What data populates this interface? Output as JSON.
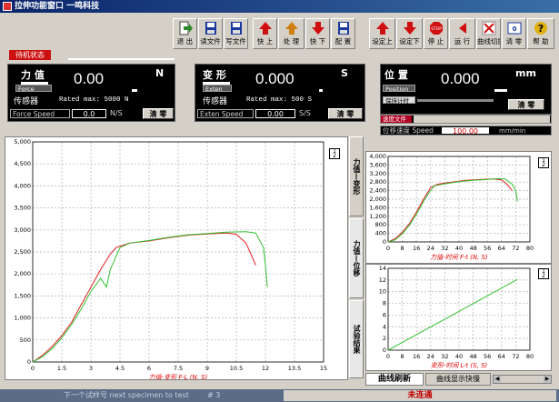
{
  "window": {
    "title": "拉伸功能窗口  一鸣科技"
  },
  "status_label": "待机状态",
  "toolbar": [
    {
      "name": "exit",
      "label": "退 出",
      "icon": "exit-icon",
      "color": "#2a8a2a"
    },
    {
      "name": "read-file",
      "label": "读文件",
      "icon": "read-file-icon",
      "color": "#1a3aa0"
    },
    {
      "name": "write-file",
      "label": "写文件",
      "icon": "write-file-icon",
      "color": "#1a3aa0"
    },
    {
      "name": "fast-up",
      "label": "快 上",
      "icon": "arrow-up-icon",
      "color": "#d01010"
    },
    {
      "name": "process",
      "label": "处 理",
      "icon": "process-icon",
      "color": "#d08010"
    },
    {
      "name": "fast-down",
      "label": "快 下",
      "icon": "arrow-down-icon",
      "color": "#d01010"
    },
    {
      "name": "config",
      "label": "配 置",
      "icon": "config-icon",
      "color": "#1a3aa0"
    },
    {
      "name": "set-up",
      "label": "设定上",
      "icon": "arrow-up-icon",
      "color": "#d01010"
    },
    {
      "name": "set-down",
      "label": "设定下",
      "icon": "arrow-down-icon",
      "color": "#d01010"
    },
    {
      "name": "stop",
      "label": "停 止",
      "icon": "stop-icon",
      "color": "#d01010"
    },
    {
      "name": "run",
      "label": "运 行",
      "icon": "run-icon",
      "color": "#d01010"
    },
    {
      "name": "curve-clear",
      "label": "曲线切换",
      "icon": "curve-switch-icon",
      "color": "#3060c0"
    },
    {
      "name": "clear-zero",
      "label": "清 零",
      "icon": "clear-zero-icon",
      "color": "#1a3aa0"
    },
    {
      "name": "help",
      "label": "帮 助",
      "icon": "help-icon",
      "color": "#e0b010"
    }
  ],
  "force": {
    "label": "力 值",
    "value": "0.00",
    "unit": "N",
    "tag": "Force",
    "sensor_label": "传感器",
    "rated": "Rated max: 5000 N",
    "speed_label": "Force Speed",
    "speed_value": "0.0",
    "speed_unit": "N/S",
    "clear_label": "清 零"
  },
  "deform": {
    "label": "变 形",
    "value": "0.000",
    "unit": "S",
    "tag": "Exten",
    "sensor_label": "传感器",
    "rated": "Rated max: 500 S",
    "speed_label": "Exten Speed",
    "speed_value": "0.00",
    "speed_unit": "S/S",
    "clear_label": "清 零"
  },
  "position": {
    "label": "位 置",
    "value": "0.000",
    "unit": "mm",
    "tag": "Position",
    "hold_label": "保持计时",
    "clear_label": "清 零",
    "speed_file_label": "速度文件",
    "speed_label": "位移速度 Speed",
    "speed_value": "100.00",
    "speed_unit": "mm/min"
  },
  "tabs": {
    "vertical": [
      "力值—变形",
      "力值—位移",
      "试验结果"
    ],
    "refresh": "曲线刷新",
    "display_speed": "曲线显示快慢"
  },
  "legend": {
    "top": "1",
    "bottom": "2"
  },
  "footer": {
    "left": "下一个试样号 next specimen to test",
    "count": "# 3",
    "status": "未连通"
  },
  "charts": {
    "main": {
      "xlabel": "力值-变形 F-L  (N, S)",
      "xlim": [
        0,
        15
      ],
      "ylim": [
        0,
        5000
      ],
      "xticks": [
        "0",
        "1.5",
        "3",
        "4.5",
        "6",
        "7.5",
        "9",
        "10.5",
        "12",
        "13.5",
        "15"
      ],
      "yticks": [
        "0",
        "500",
        "1,000",
        "1,500",
        "2,000",
        "2,500",
        "3,000",
        "3,500",
        "4,000",
        "4,500",
        "5,000"
      ],
      "series": [
        {
          "color": "#e02020",
          "points": [
            [
              0,
              0
            ],
            [
              0.5,
              150
            ],
            [
              1,
              350
            ],
            [
              1.5,
              600
            ],
            [
              2,
              900
            ],
            [
              2.5,
              1300
            ],
            [
              3,
              1700
            ],
            [
              3.5,
              2100
            ],
            [
              4,
              2450
            ],
            [
              4.3,
              2600
            ],
            [
              5,
              2700
            ],
            [
              6,
              2750
            ],
            [
              7,
              2820
            ],
            [
              8,
              2880
            ],
            [
              9,
              2910
            ],
            [
              10,
              2930
            ],
            [
              10.5,
              2900
            ],
            [
              11,
              2700
            ],
            [
              11.3,
              2400
            ],
            [
              11.5,
              2200
            ]
          ]
        },
        {
          "color": "#30c030",
          "points": [
            [
              0,
              0
            ],
            [
              0.5,
              120
            ],
            [
              1,
              300
            ],
            [
              1.5,
              550
            ],
            [
              2,
              850
            ],
            [
              2.5,
              1200
            ],
            [
              3,
              1600
            ],
            [
              3.5,
              1900
            ],
            [
              3.8,
              1700
            ],
            [
              4,
              2100
            ],
            [
              4.2,
              2300
            ],
            [
              4.5,
              2600
            ],
            [
              5,
              2700
            ],
            [
              6,
              2760
            ],
            [
              7,
              2830
            ],
            [
              8,
              2890
            ],
            [
              9,
              2920
            ],
            [
              10,
              2950
            ],
            [
              11,
              2960
            ],
            [
              11.5,
              2930
            ],
            [
              11.9,
              2600
            ],
            [
              12,
              2200
            ],
            [
              12.1,
              1700
            ]
          ]
        }
      ]
    },
    "top": {
      "xlabel": "力值-时间 F-t  (N, S)",
      "xlim": [
        0,
        80
      ],
      "ylim": [
        0,
        4000
      ],
      "xticks": [
        "0",
        "8",
        "16",
        "24",
        "32",
        "40",
        "48",
        "56",
        "64",
        "72",
        "80"
      ],
      "yticks": [
        "0",
        "400",
        "800",
        "1,200",
        "1,600",
        "2,000",
        "2,400",
        "2,800",
        "3,200",
        "3,600",
        "4,000"
      ],
      "series": [
        {
          "color": "#e02020",
          "points": [
            [
              0,
              0
            ],
            [
              4,
              150
            ],
            [
              8,
              450
            ],
            [
              12,
              850
            ],
            [
              16,
              1400
            ],
            [
              20,
              2000
            ],
            [
              24,
              2550
            ],
            [
              28,
              2700
            ],
            [
              36,
              2800
            ],
            [
              44,
              2880
            ],
            [
              52,
              2920
            ],
            [
              60,
              2950
            ],
            [
              64,
              2900
            ],
            [
              67,
              2700
            ],
            [
              70,
              2400
            ]
          ]
        },
        {
          "color": "#30c030",
          "points": [
            [
              0,
              0
            ],
            [
              4,
              100
            ],
            [
              8,
              380
            ],
            [
              12,
              780
            ],
            [
              16,
              1300
            ],
            [
              20,
              1900
            ],
            [
              23,
              2300
            ],
            [
              26,
              2620
            ],
            [
              32,
              2720
            ],
            [
              40,
              2820
            ],
            [
              48,
              2880
            ],
            [
              56,
              2920
            ],
            [
              62,
              2960
            ],
            [
              66,
              2950
            ],
            [
              70,
              2700
            ],
            [
              72,
              2400
            ],
            [
              73,
              1900
            ]
          ]
        }
      ]
    },
    "bottom": {
      "xlabel": "变形-时间 L-t  (S, S)",
      "xlim": [
        0,
        80
      ],
      "ylim": [
        0,
        14
      ],
      "xticks": [
        "0",
        "8",
        "16",
        "24",
        "32",
        "40",
        "48",
        "56",
        "64",
        "72",
        "80"
      ],
      "yticks": [
        "0",
        "2",
        "4",
        "6",
        "8",
        "10",
        "12",
        "14"
      ],
      "series": [
        {
          "color": "#30c030",
          "points": [
            [
              0,
              0
            ],
            [
              73,
              12.1
            ]
          ]
        }
      ]
    }
  }
}
